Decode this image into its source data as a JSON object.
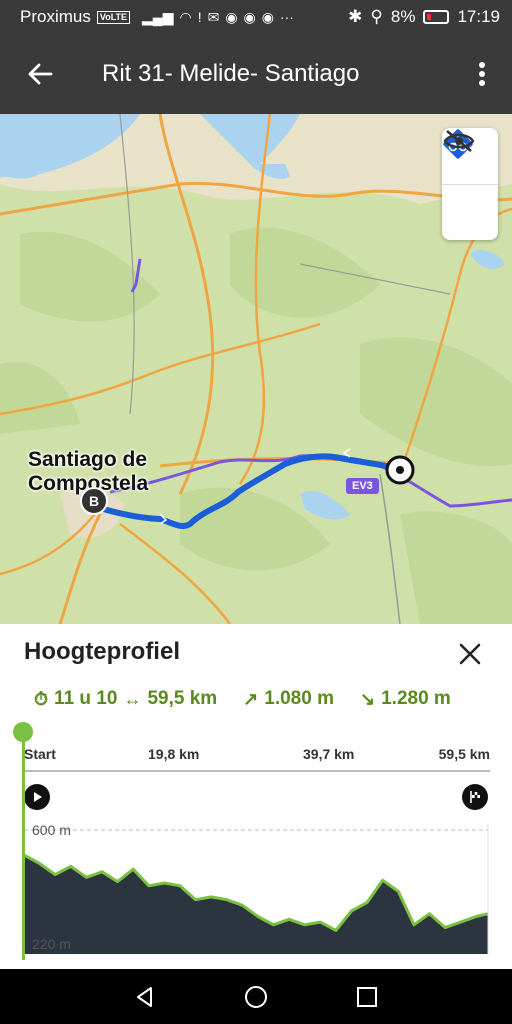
{
  "status": {
    "carrier": "Proximus",
    "volte": "VoLTE",
    "battery": "8%",
    "time": "17:19"
  },
  "header": {
    "title": "Rit 31- Melide- Santiago"
  },
  "map": {
    "city_line1": "Santiago de",
    "city_line2": "Compostela",
    "end_marker": "B",
    "route_badge": "EV3",
    "route_color": "#1a5fd6",
    "cycle_route_color": "#7a55e0"
  },
  "sheet": {
    "title": "Hoogteprofiel",
    "duration": "11 u 10",
    "distance": "59,5 km",
    "ascent": "1.080 m",
    "descent": "1.280 m",
    "stats_color": "#5a8a1e"
  },
  "axis": {
    "start": "Start",
    "mark1": "19,8 km",
    "mark2": "39,7 km",
    "mark3": "59,5 km"
  },
  "chart_data": {
    "type": "area",
    "title": "",
    "xlabel": "",
    "ylabel": "",
    "ylim": [
      220,
      600
    ],
    "y_ticks": [
      "600 m",
      "220 m"
    ],
    "x": [
      0,
      2,
      4,
      6,
      8,
      10,
      12,
      14,
      16,
      18,
      20,
      22,
      24,
      26,
      28,
      30,
      32,
      34,
      36,
      38,
      40,
      42,
      44,
      46,
      48,
      50,
      52,
      54,
      56,
      58,
      59.5
    ],
    "values": [
      510,
      480,
      440,
      470,
      430,
      450,
      415,
      460,
      400,
      410,
      400,
      350,
      360,
      350,
      330,
      290,
      260,
      280,
      260,
      270,
      240,
      310,
      340,
      420,
      380,
      260,
      300,
      250,
      270,
      290,
      300
    ]
  }
}
